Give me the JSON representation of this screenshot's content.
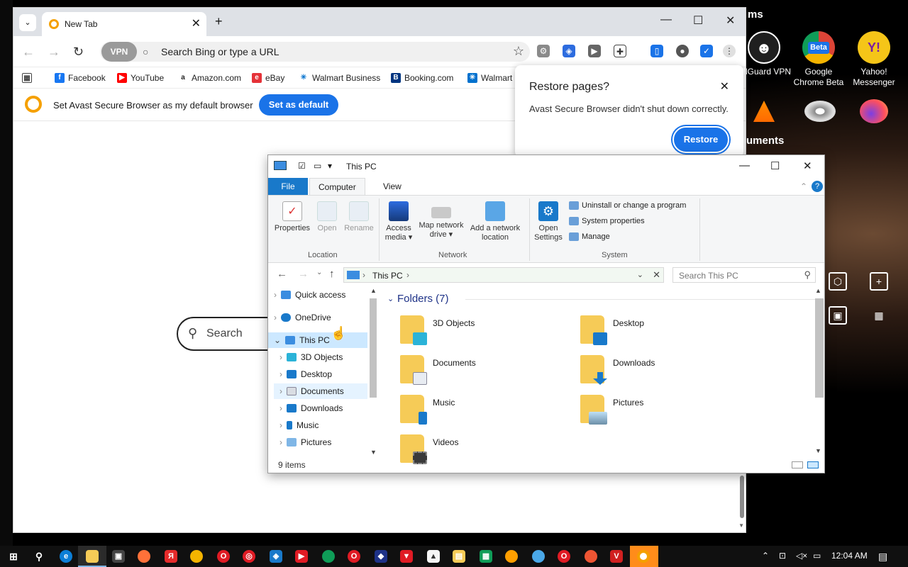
{
  "desktop": {
    "icons": [
      {
        "label": "AdGuard VPN",
        "color": "#ffffff",
        "glyph": "☻"
      },
      {
        "label": "Google Chrome Beta",
        "color": "#1a73e8",
        "glyph": "Beta"
      },
      {
        "label": "Yahoo! Messenger",
        "color": "#7b1fa2",
        "glyph": "Y!"
      }
    ],
    "partial_labels": {
      "top": "ms",
      "mid": "uments"
    }
  },
  "browser": {
    "tab_title": "New Tab",
    "vpn_label": "VPN",
    "omnibox_placeholder": "Search Bing or type a URL",
    "bookmarks": [
      "Facebook",
      "YouTube",
      "Amazon.com",
      "eBay",
      "Walmart Business",
      "Booking.com",
      "Walmart"
    ],
    "banner_text": "Set Avast Secure Browser as my default browser",
    "banner_button": "Set as default",
    "page_search_placeholder": "Search"
  },
  "restore_popup": {
    "title": "Restore pages?",
    "message": "Avast Secure Browser didn't shut down correctly.",
    "button": "Restore"
  },
  "explorer": {
    "title": "This PC",
    "ribbon_tabs": [
      "File",
      "Computer",
      "View"
    ],
    "ribbon": {
      "location": {
        "label": "Location",
        "buttons": [
          "Properties",
          "Open",
          "Rename"
        ]
      },
      "network": {
        "label": "Network",
        "buttons": [
          "Access media ▾",
          "Map network drive ▾",
          "Add a network location"
        ]
      },
      "system": {
        "label": "System",
        "open_settings": "Open Settings",
        "items": [
          "Uninstall or change a program",
          "System properties",
          "Manage"
        ]
      }
    },
    "address": "This PC",
    "search_placeholder": "Search This PC",
    "nav_items": [
      {
        "label": "Quick access",
        "indent": 0
      },
      {
        "label": "OneDrive",
        "indent": 0
      },
      {
        "label": "This PC",
        "indent": 0
      },
      {
        "label": "3D Objects",
        "indent": 1
      },
      {
        "label": "Desktop",
        "indent": 1
      },
      {
        "label": "Documents",
        "indent": 1
      },
      {
        "label": "Downloads",
        "indent": 1
      },
      {
        "label": "Music",
        "indent": 1
      },
      {
        "label": "Pictures",
        "indent": 1
      }
    ],
    "folders_header": "Folders (7)",
    "folders": [
      "3D Objects",
      "Desktop",
      "Documents",
      "Downloads",
      "Music",
      "Pictures",
      "Videos"
    ],
    "status": "9 items"
  },
  "taskbar": {
    "clock": "12:04 AM"
  }
}
